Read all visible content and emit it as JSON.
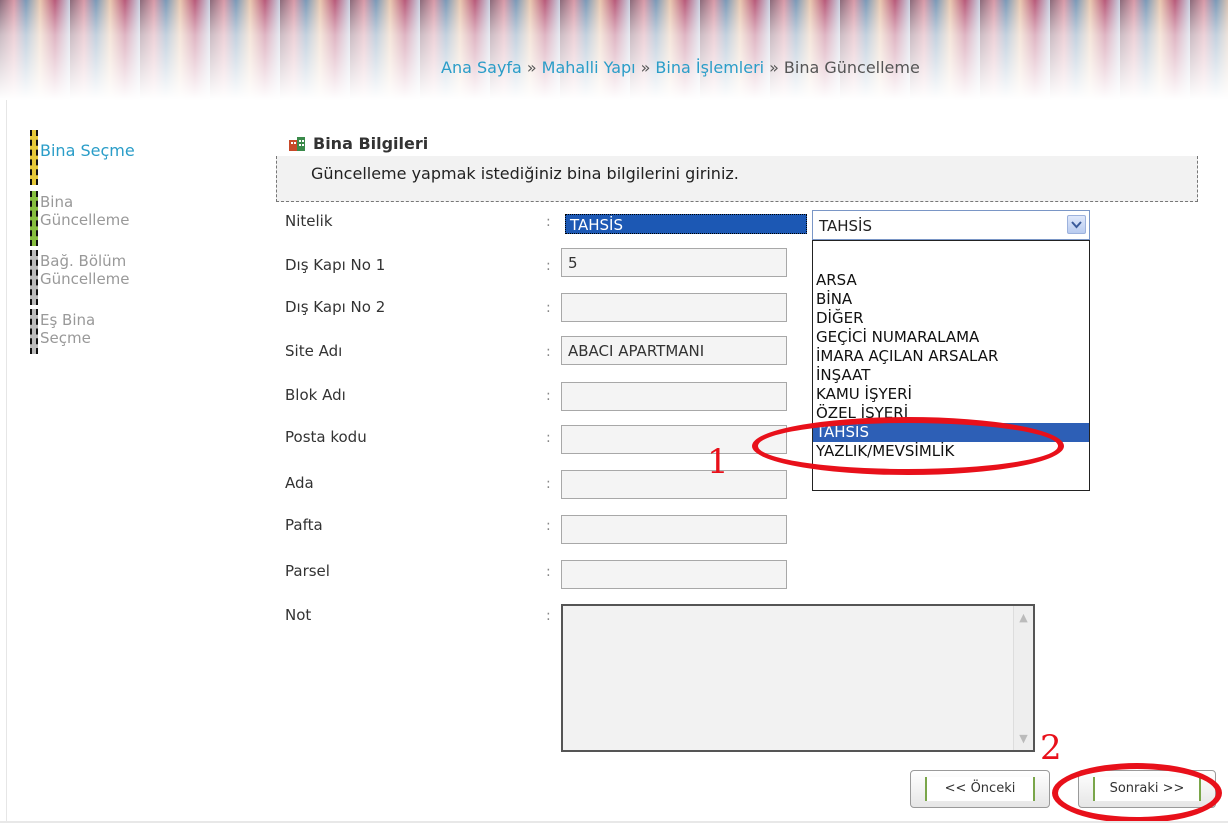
{
  "breadcrumb": {
    "items": [
      "Ana Sayfa",
      "Mahalli Yapı",
      "Bina İşlemleri",
      "Bina Güncelleme"
    ],
    "separator": "»"
  },
  "steps": [
    {
      "label_line1": "Bina Seçme",
      "label_line2": "",
      "state": "active"
    },
    {
      "label_line1": "Bina",
      "label_line2": "Güncelleme",
      "state": "inactive"
    },
    {
      "label_line1": "Bağ. Bölüm",
      "label_line2": "Güncelleme",
      "state": "inactive"
    },
    {
      "label_line1": "Eş Bina",
      "label_line2": "Seçme",
      "state": "inactive"
    }
  ],
  "section": {
    "title": "Bina Bilgileri",
    "info": "Güncelleme yapmak istediğiniz bina bilgilerini giriniz."
  },
  "form": {
    "colon": ":",
    "nitelik": {
      "label": "Nitelik",
      "value": "TAHSİS"
    },
    "dis_kapi_no_1": {
      "label": "Dış Kapı No 1",
      "value": "5"
    },
    "dis_kapi_no_2": {
      "label": "Dış Kapı No 2",
      "value": ""
    },
    "site_adi": {
      "label": "Site Adı",
      "value": "ABACI APARTMANI"
    },
    "blok_adi": {
      "label": "Blok Adı",
      "value": ""
    },
    "posta_kodu": {
      "label": "Posta kodu",
      "value": ""
    },
    "ada": {
      "label": "Ada",
      "value": ""
    },
    "pafta": {
      "label": "Pafta",
      "value": ""
    },
    "parsel": {
      "label": "Parsel",
      "value": ""
    },
    "not": {
      "label": "Not",
      "value": ""
    }
  },
  "dropdown": {
    "selected": "TAHSİS",
    "options": [
      "ARSA",
      "BİNA",
      "DİĞER",
      "GEÇİCİ NUMARALAMA",
      "İMARA AÇILAN ARSALAR",
      "İNŞAAT",
      "KAMU İŞYERİ",
      "ÖZEL İŞYERİ",
      "TAHSİS",
      "YAZLIK/MEVSİMLİK"
    ],
    "highlighted": "TAHSİS"
  },
  "buttons": {
    "prev": "<< Önceki",
    "next": "Sonraki >>"
  },
  "annotations": {
    "marker1": "1",
    "marker2": "2",
    "color": "#e8101a"
  },
  "colors": {
    "link": "#2a9dc8",
    "selection": "#1c58b4",
    "step_active": "#e6c93a",
    "step_done": "#88c040"
  }
}
